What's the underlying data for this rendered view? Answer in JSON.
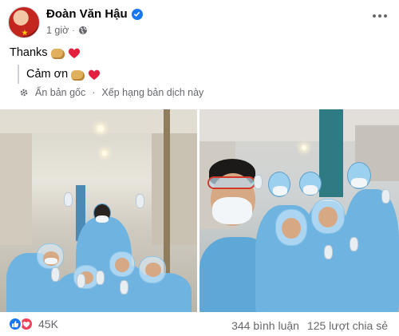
{
  "author": {
    "name": "Đoàn Văn Hậu",
    "time": "1 giờ"
  },
  "post": {
    "text": "Thanks",
    "translated_text": "Cảm ơn"
  },
  "translation": {
    "see_original": "Ẩn bản gốc",
    "rate_translation": "Xếp hạng bản dịch này"
  },
  "footer": {
    "reaction_count": "45K",
    "comments": "344 bình luận",
    "shares": "125 lượt chia sẻ"
  },
  "icons": {
    "verified": "verified-badge-icon",
    "privacy": "globe-icon",
    "settings": "gear-icon",
    "more": "more-options-icon",
    "reactions": [
      "like-icon",
      "love-icon"
    ],
    "emoji": [
      "oncoming-fist-emoji",
      "red-heart-emoji"
    ]
  },
  "colors": {
    "brand_blue": "#1877f2",
    "love_red": "#f33e58",
    "secondary_text": "#65676b",
    "ppe_blue": "#6fb4e0"
  }
}
